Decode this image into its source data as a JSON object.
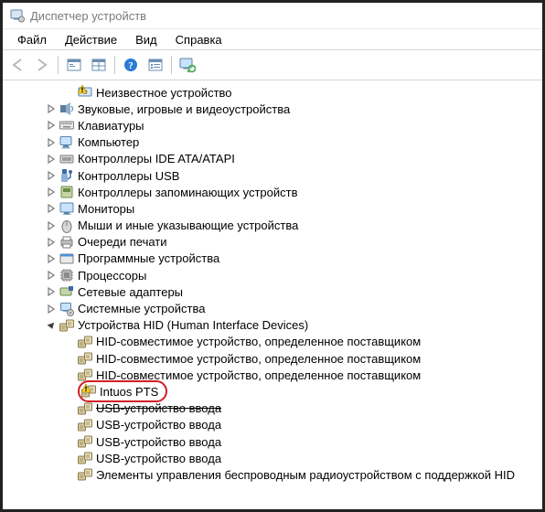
{
  "window_title": "Диспетчер устройств",
  "menu": [
    "Файл",
    "Действие",
    "Вид",
    "Справка"
  ],
  "toolbar_icons": [
    "back",
    "forward",
    "window",
    "grid",
    "help",
    "props",
    "monitor"
  ],
  "tree": [
    {
      "depth": 2,
      "expander": "none",
      "icon": "unknown",
      "warn": true,
      "label": "Неизвестное устройство"
    },
    {
      "depth": 1,
      "expander": "closed",
      "icon": "audio",
      "warn": false,
      "label": "Звуковые, игровые и видеоустройства"
    },
    {
      "depth": 1,
      "expander": "closed",
      "icon": "keyboard",
      "warn": false,
      "label": "Клавиатуры"
    },
    {
      "depth": 1,
      "expander": "closed",
      "icon": "computer",
      "warn": false,
      "label": "Компьютер"
    },
    {
      "depth": 1,
      "expander": "closed",
      "icon": "ide",
      "warn": false,
      "label": "Контроллеры IDE ATA/ATAPI"
    },
    {
      "depth": 1,
      "expander": "closed",
      "icon": "usb",
      "warn": false,
      "label": "Контроллеры USB"
    },
    {
      "depth": 1,
      "expander": "closed",
      "icon": "storage",
      "warn": false,
      "label": "Контроллеры запоминающих устройств"
    },
    {
      "depth": 1,
      "expander": "closed",
      "icon": "monitor",
      "warn": false,
      "label": "Мониторы"
    },
    {
      "depth": 1,
      "expander": "closed",
      "icon": "mouse",
      "warn": false,
      "label": "Мыши и иные указывающие устройства"
    },
    {
      "depth": 1,
      "expander": "closed",
      "icon": "printer",
      "warn": false,
      "label": "Очереди печати"
    },
    {
      "depth": 1,
      "expander": "closed",
      "icon": "software",
      "warn": false,
      "label": "Программные устройства"
    },
    {
      "depth": 1,
      "expander": "closed",
      "icon": "cpu",
      "warn": false,
      "label": "Процессоры"
    },
    {
      "depth": 1,
      "expander": "closed",
      "icon": "network",
      "warn": false,
      "label": "Сетевые адаптеры"
    },
    {
      "depth": 1,
      "expander": "closed",
      "icon": "system",
      "warn": false,
      "label": "Системные устройства"
    },
    {
      "depth": 1,
      "expander": "open",
      "icon": "hid",
      "warn": false,
      "label": "Устройства HID (Human Interface Devices)"
    },
    {
      "depth": 2,
      "expander": "none",
      "icon": "hid",
      "warn": false,
      "label": "HID-совместимое устройство, определенное поставщиком"
    },
    {
      "depth": 2,
      "expander": "none",
      "icon": "hid",
      "warn": false,
      "label": "HID-совместимое устройство, определенное поставщиком"
    },
    {
      "depth": 2,
      "expander": "none",
      "icon": "hid",
      "warn": false,
      "label": "HID-совместимое устройство, определенное поставщиком"
    },
    {
      "depth": 2,
      "expander": "none",
      "icon": "hid",
      "warn": true,
      "label": "Intuos PTS",
      "highlight": true
    },
    {
      "depth": 2,
      "expander": "none",
      "icon": "hid",
      "warn": false,
      "label": "USB-устройство ввода",
      "strike": true
    },
    {
      "depth": 2,
      "expander": "none",
      "icon": "hid",
      "warn": false,
      "label": "USB-устройство ввода"
    },
    {
      "depth": 2,
      "expander": "none",
      "icon": "hid",
      "warn": false,
      "label": "USB-устройство ввода"
    },
    {
      "depth": 2,
      "expander": "none",
      "icon": "hid",
      "warn": false,
      "label": "USB-устройство ввода"
    },
    {
      "depth": 2,
      "expander": "none",
      "icon": "hid",
      "warn": false,
      "label": "Элементы управления беспроводным радиоустройством с поддержкой HID"
    }
  ]
}
